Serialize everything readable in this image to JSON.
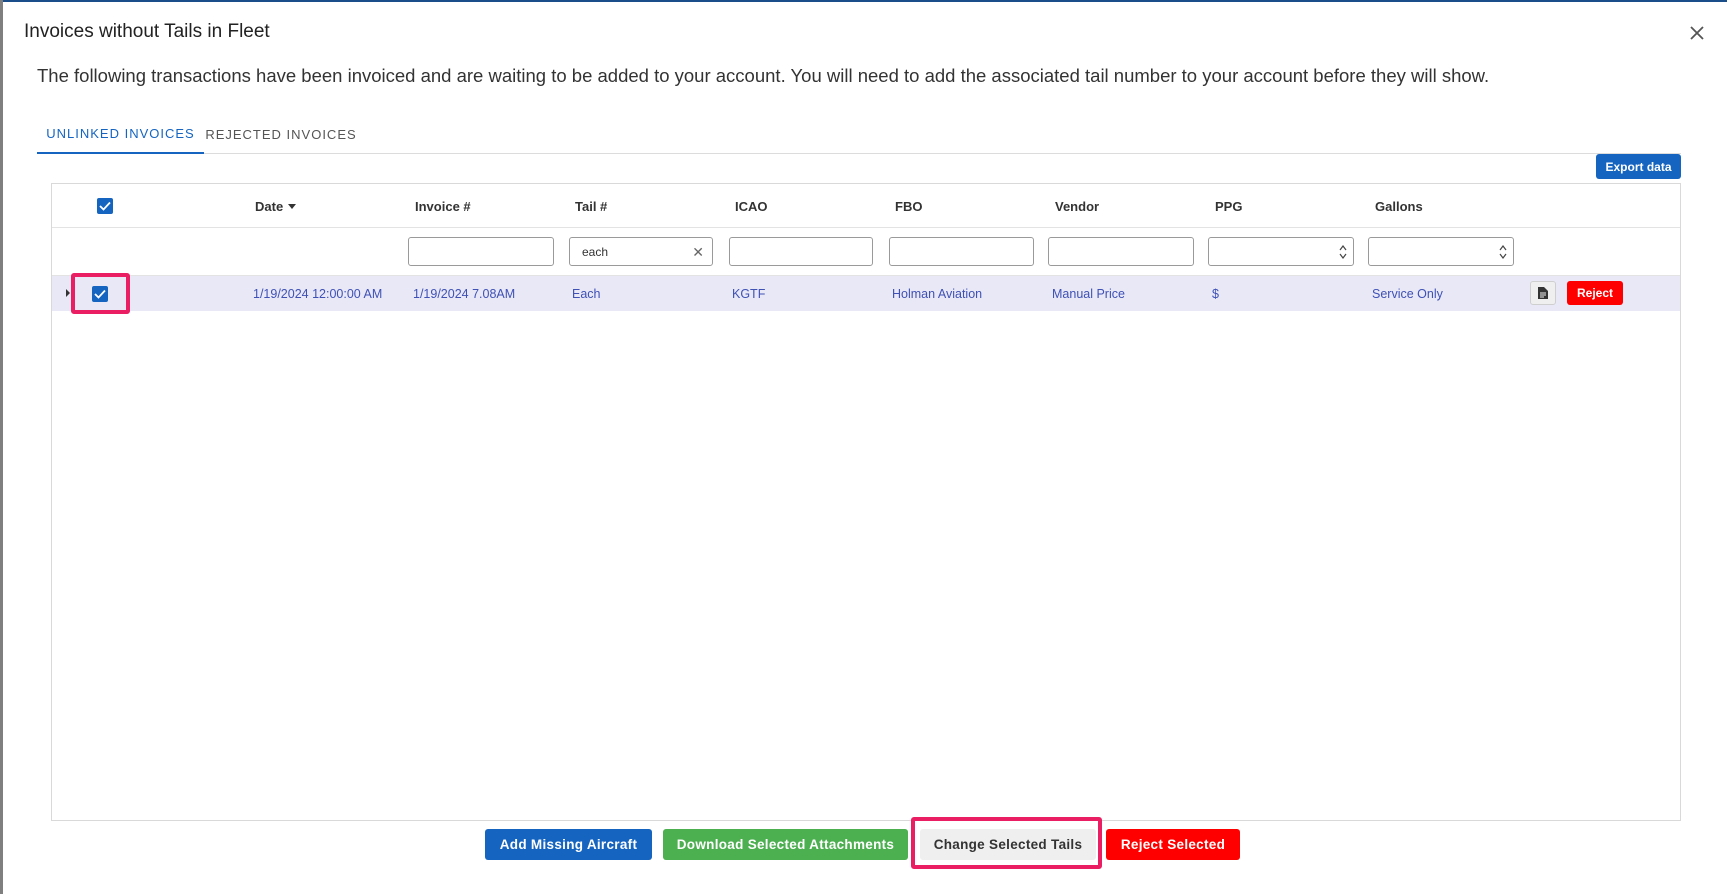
{
  "modal": {
    "title": "Invoices without Tails in Fleet",
    "description": "The following transactions have been invoiced and are waiting to be added to your account. You will need to add the associated tail number to your account before they will show."
  },
  "tabs": [
    {
      "label": "UNLINKED INVOICES",
      "active": true
    },
    {
      "label": "REJECTED INVOICES",
      "active": false
    }
  ],
  "toolbar": {
    "export_label": "Export data"
  },
  "grid": {
    "columns": [
      "Date",
      "Invoice #",
      "Tail #",
      "ICAO",
      "FBO",
      "Vendor",
      "PPG",
      "Gallons"
    ],
    "sort_column": "Date",
    "sort_direction": "descending",
    "filters": {
      "tail": "each"
    },
    "rows": [
      {
        "selected": true,
        "date": "1/19/2024 12:00:00 AM",
        "invoice": "1/19/2024 7.08AM",
        "tail": "Each",
        "icao": "KGTF",
        "fbo": "Holman Aviation",
        "vendor": "Manual Price",
        "ppg": "$",
        "gallons": "Service Only",
        "reject_label": "Reject"
      }
    ]
  },
  "footer": {
    "add_missing": "Add Missing Aircraft",
    "download": "Download Selected Attachments",
    "change_tails": "Change Selected Tails",
    "reject_selected": "Reject Selected"
  },
  "colors": {
    "primary": "#1565c0",
    "success": "#4caf50",
    "danger": "#ff0000",
    "highlight": "#ea1e63",
    "row_selected": "#e8e8f7",
    "link_text": "#3f51b5"
  },
  "icons": [
    "close-icon",
    "checkmark-icon",
    "sort-desc-icon",
    "clear-icon",
    "spinner-icon",
    "document-icon",
    "expand-icon"
  ]
}
